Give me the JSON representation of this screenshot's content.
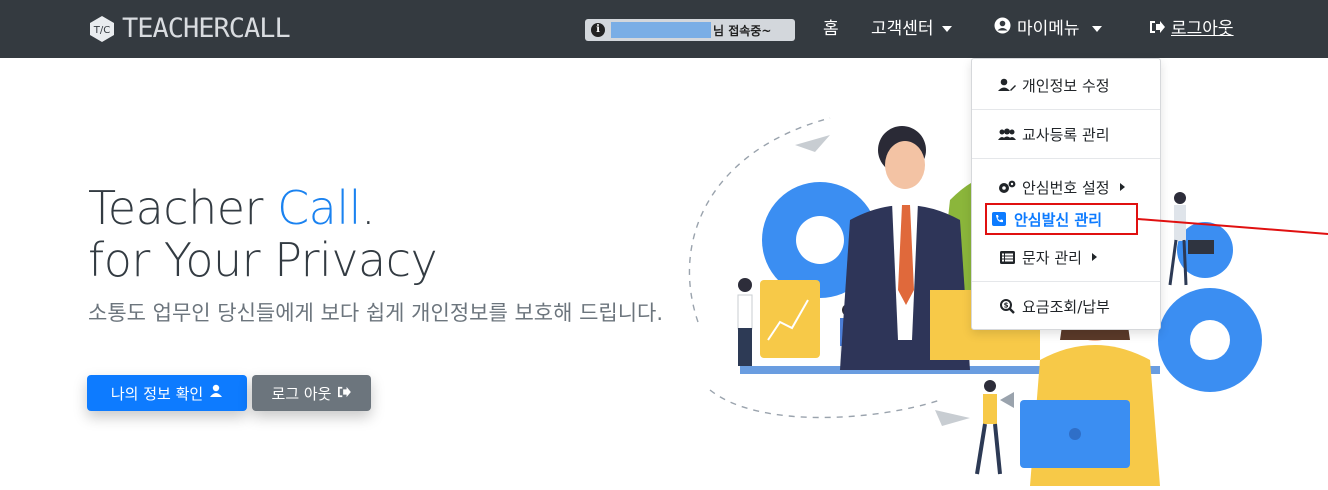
{
  "brand": {
    "logo_mark": "T/C",
    "name": "TEACHERCALL"
  },
  "navbar": {
    "status_text": "님 접속중~",
    "home": "홈",
    "support": "고객센터",
    "mymenu": "마이메뉴",
    "logout": "로그아웃"
  },
  "hero": {
    "title_part1": "Teacher ",
    "title_accent": "Call",
    "title_dot": ".",
    "title_line2": "for Your Privacy",
    "subtitle": "소통도 업무인 당신들에게 보다 쉽게 개인정보를 보호해 드립니다.",
    "primary_button": "나의 정보 확인",
    "secondary_button": "로그 아웃"
  },
  "dropdown": {
    "items": [
      {
        "label": "개인정보 수정",
        "icon": "user-edit-icon"
      },
      {
        "label": "교사등록 관리",
        "icon": "users-icon"
      },
      {
        "label": "안심번호 설정",
        "icon": "cogs-icon",
        "submenu": true
      },
      {
        "label": "안심발신 관리",
        "icon": "phone-square-icon",
        "highlighted": true
      },
      {
        "label": "문자 관리",
        "icon": "list-icon",
        "submenu": true
      },
      {
        "label": "요금조회/납부",
        "icon": "search-dollar-icon"
      }
    ]
  },
  "colors": {
    "navbar_bg": "#343a40",
    "accent": "#1a82f0",
    "primary_button": "#0d7bff",
    "secondary_button": "#6c757d",
    "highlight_box": "#e01010"
  }
}
